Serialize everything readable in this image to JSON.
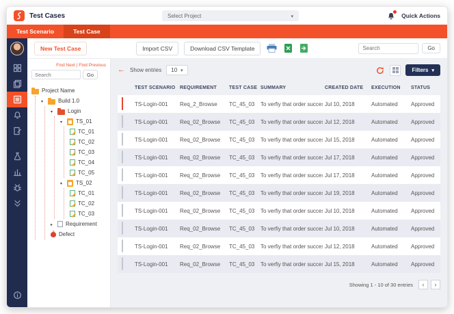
{
  "topbar": {
    "title": "Test Cases",
    "project_select": "Select Project",
    "quick_actions": "Quick Actions"
  },
  "tabs": {
    "scenario": "Test Scenario",
    "case": "Test Case"
  },
  "toolbar": {
    "new_test_case": "New Test Case",
    "import_csv": "Import CSV",
    "download_csv": "Download CSV Template",
    "search_placeholder": "Search",
    "go": "Go"
  },
  "tree": {
    "find_next": "Find Next",
    "find_prev": "Find Previous",
    "search_placeholder": "Search",
    "go": "Go",
    "project": "Project Name",
    "build": "Build 1.0",
    "login": "Login",
    "ts01": "TS_01",
    "ts01_children": [
      "TC_01",
      "TC_02",
      "TC_03",
      "TC_04",
      "TC_05"
    ],
    "ts02": "TS_02",
    "ts02_children": [
      "TC_01",
      "TC_02",
      "TC_03"
    ],
    "requirement": "Requirement",
    "defect": "Defect"
  },
  "controls": {
    "show_entries": "Show entries",
    "page_size": "10",
    "filters": "Filters"
  },
  "table": {
    "headers": [
      "TEST SCENARIO",
      "REQUIREMENT",
      "TEST CASE",
      "SUMMARY",
      "CREATED DATE",
      "EXECUTION",
      "STATUS"
    ],
    "rows": [
      {
        "checked": true,
        "scenario": "TS-Login-001",
        "requirement": "Req_2_Browse",
        "test_case": "TC_45_03",
        "summary": "To verfiy that order successfully...",
        "created": "Jul 10, 2018",
        "execution": "Automated",
        "status": "Approved"
      },
      {
        "checked": false,
        "scenario": "TS-Login-001",
        "requirement": "Req_02_Browse",
        "test_case": "TC_45_03",
        "summary": "To verfiy that order successfully...",
        "created": "Jul 12, 2018",
        "execution": "Automated",
        "status": "Approved"
      },
      {
        "checked": false,
        "scenario": "TS-Login-001",
        "requirement": "Req_02_Browse",
        "test_case": "TC_45_03",
        "summary": "To verfiy that order successfully...",
        "created": "Jul 15, 2018",
        "execution": "Automated",
        "status": "Approved"
      },
      {
        "checked": false,
        "scenario": "TS-Login-001",
        "requirement": "Req_02_Browse",
        "test_case": "TC_45_03",
        "summary": "To verfiy that order successfully...",
        "created": "Jul 17, 2018",
        "execution": "Automated",
        "status": "Approved"
      },
      {
        "checked": false,
        "scenario": "TS-Login-001",
        "requirement": "Req_02_Browse",
        "test_case": "TC_45_03",
        "summary": "To verfiy that order successfully...",
        "created": "Jul 17, 2018",
        "execution": "Automated",
        "status": "Approved"
      },
      {
        "checked": false,
        "scenario": "TS-Login-001",
        "requirement": "Req_02_Browse",
        "test_case": "TC_45_03",
        "summary": "To verfiy that order successfully...",
        "created": "Jul 19, 2018",
        "execution": "Automated",
        "status": "Approved"
      },
      {
        "checked": false,
        "scenario": "TS-Login-001",
        "requirement": "Req_02_Browse",
        "test_case": "TC_45_03",
        "summary": "To verfiy that order successfully...",
        "created": "Jul 10, 2018",
        "execution": "Automated",
        "status": "Approved"
      },
      {
        "checked": false,
        "scenario": "TS-Login-001",
        "requirement": "Req_02_Browse",
        "test_case": "TC_45_03",
        "summary": "To verfiy that order successfully...",
        "created": "Jul 10, 2018",
        "execution": "Automated",
        "status": "Approved"
      },
      {
        "checked": false,
        "scenario": "TS-Login-001",
        "requirement": "Req_02_Browse",
        "test_case": "TC_45_03",
        "summary": "To verfiy that order successfully...",
        "created": "Jul 12, 2018",
        "execution": "Automated",
        "status": "Approved"
      },
      {
        "checked": false,
        "scenario": "TS-Login-001",
        "requirement": "Req_02_Browse",
        "test_case": "TC_45_03",
        "summary": "To verfiy that order successfully...",
        "created": "Jul 15, 2018",
        "execution": "Automated",
        "status": "Approved"
      }
    ]
  },
  "pagination": {
    "summary": "Showing 1 - 10 of 30 entries",
    "prev": "‹",
    "next": "›"
  },
  "icons": {
    "logo": "brand-logo",
    "bell": "notification-bell",
    "print": "printer",
    "export_excel": "excel-export",
    "export_file": "file-export",
    "refresh": "refresh-arrow",
    "chevron": "chevron-down"
  },
  "colors": {
    "accent": "#f2512a",
    "navy": "#212b4d",
    "checked": "#e8432a",
    "row_alt": "#e9eaf2"
  }
}
